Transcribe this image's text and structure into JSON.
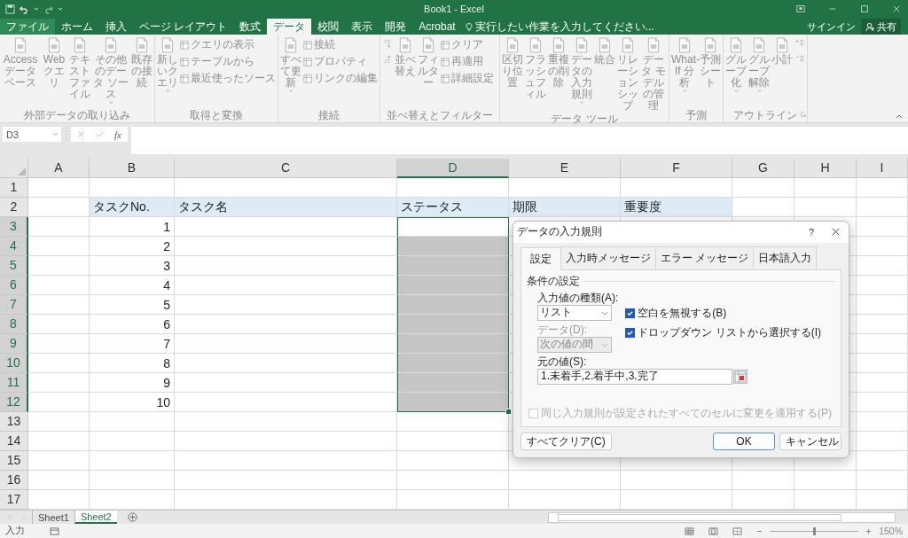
{
  "window": {
    "title": "Book1 - Excel"
  },
  "ribbon_tabs": [
    {
      "label": "ファイル",
      "selected": false,
      "kind": "file"
    },
    {
      "label": "ホーム",
      "selected": false
    },
    {
      "label": "挿入",
      "selected": false
    },
    {
      "label": "ページ レイアウト",
      "selected": false
    },
    {
      "label": "数式",
      "selected": false
    },
    {
      "label": "データ",
      "selected": true
    },
    {
      "label": "校閲",
      "selected": false
    },
    {
      "label": "表示",
      "selected": false
    },
    {
      "label": "開発",
      "selected": false
    },
    {
      "label": "Acrobat",
      "selected": false
    }
  ],
  "tell_me": {
    "placeholder": "実行したい作業を入力してください..."
  },
  "sign_in": "サインイン",
  "share": "共有",
  "ribbon": {
    "enabled": false,
    "groups": [
      {
        "label": "外部データの取り込み",
        "items": [
          {
            "kind": "large",
            "label": "Access データベース"
          },
          {
            "kind": "large",
            "label": "Web クエリ"
          },
          {
            "kind": "large",
            "label": "テキストファイル"
          },
          {
            "kind": "large",
            "label": "その他のデータ ソース",
            "dropdown": true
          },
          {
            "kind": "large",
            "label": "既存の接続"
          }
        ]
      },
      {
        "label": "取得と変換",
        "items": [
          {
            "kind": "large",
            "label": "新しいクエリ",
            "dropdown": true
          },
          {
            "kind": "small",
            "label": "クエリの表示"
          },
          {
            "kind": "small",
            "label": "テーブルから"
          },
          {
            "kind": "small",
            "label": "最近使ったソース"
          }
        ]
      },
      {
        "label": "接続",
        "items": [
          {
            "kind": "large",
            "label": "すべて更新",
            "dropdown": true
          },
          {
            "kind": "small",
            "label": "接続"
          },
          {
            "kind": "small",
            "label": "プロパティ"
          },
          {
            "kind": "small",
            "label": "リンクの編集"
          }
        ]
      },
      {
        "label": "並べ替えとフィルター",
        "items": [
          {
            "kind": "sort"
          },
          {
            "kind": "large",
            "label": "並べ替え"
          },
          {
            "kind": "large",
            "label": "フィルター"
          },
          {
            "kind": "small",
            "label": "クリア"
          },
          {
            "kind": "small",
            "label": "再適用"
          },
          {
            "kind": "small",
            "label": "詳細設定"
          }
        ]
      },
      {
        "label": "データ ツール",
        "items": [
          {
            "kind": "large",
            "label": "区切り位置"
          },
          {
            "kind": "large",
            "label": "フラッシュフィル"
          },
          {
            "kind": "large",
            "label": "重複の削除"
          },
          {
            "kind": "large",
            "label": "データの入力規則",
            "dropdown": true
          },
          {
            "kind": "large",
            "label": "統合"
          },
          {
            "kind": "large",
            "label": "リレーションシップ"
          },
          {
            "kind": "large",
            "label": "データ モデルの管理"
          }
        ]
      },
      {
        "label": "予測",
        "items": [
          {
            "kind": "large",
            "label": "What-If 分析",
            "dropdown": true
          },
          {
            "kind": "large",
            "label": "予測シート"
          }
        ]
      },
      {
        "label": "アウトライン",
        "launcher": true,
        "items": [
          {
            "kind": "large",
            "label": "グループ化",
            "dropdown": true
          },
          {
            "kind": "large",
            "label": "グループ解除",
            "dropdown": true
          },
          {
            "kind": "large",
            "label": "小計"
          },
          {
            "kind": "outline"
          }
        ]
      }
    ]
  },
  "formula_bar": {
    "name_box": "D3",
    "function_label": "fx"
  },
  "sheet": {
    "columns": [
      {
        "label": "A",
        "selected": false
      },
      {
        "label": "B",
        "selected": false
      },
      {
        "label": "C",
        "selected": false
      },
      {
        "label": "D",
        "selected": true
      },
      {
        "label": "E",
        "selected": false
      },
      {
        "label": "F",
        "selected": false
      },
      {
        "label": "G",
        "selected": false
      },
      {
        "label": "H",
        "selected": false
      },
      {
        "label": "I",
        "selected": false
      }
    ],
    "rows": [
      {
        "label": "1",
        "selected": false,
        "cells": []
      },
      {
        "label": "2",
        "selected": false,
        "kind": "header",
        "cells": [
          {
            "text": "",
            "kind": "text"
          },
          {
            "text": "タスクNo.",
            "kind": "text"
          },
          {
            "text": "タスク名",
            "kind": "text"
          },
          {
            "text": "ステータス",
            "kind": "text"
          },
          {
            "text": "期限",
            "kind": "text"
          },
          {
            "text": "重要度",
            "kind": "text"
          }
        ]
      },
      {
        "label": "3",
        "selected": true,
        "cells": [
          {
            "text": "",
            "kind": "text"
          },
          {
            "text": "1",
            "kind": "number"
          }
        ]
      },
      {
        "label": "4",
        "selected": true,
        "cells": [
          {
            "text": "",
            "kind": "text"
          },
          {
            "text": "2",
            "kind": "number"
          }
        ]
      },
      {
        "label": "5",
        "selected": true,
        "cells": [
          {
            "text": "",
            "kind": "text"
          },
          {
            "text": "3",
            "kind": "number"
          }
        ]
      },
      {
        "label": "6",
        "selected": true,
        "cells": [
          {
            "text": "",
            "kind": "text"
          },
          {
            "text": "4",
            "kind": "number"
          }
        ]
      },
      {
        "label": "7",
        "selected": true,
        "cells": [
          {
            "text": "",
            "kind": "text"
          },
          {
            "text": "5",
            "kind": "number"
          }
        ]
      },
      {
        "label": "8",
        "selected": true,
        "cells": [
          {
            "text": "",
            "kind": "text"
          },
          {
            "text": "6",
            "kind": "number"
          }
        ]
      },
      {
        "label": "9",
        "selected": true,
        "cells": [
          {
            "text": "",
            "kind": "text"
          },
          {
            "text": "7",
            "kind": "number"
          }
        ]
      },
      {
        "label": "10",
        "selected": true,
        "cells": [
          {
            "text": "",
            "kind": "text"
          },
          {
            "text": "8",
            "kind": "number"
          }
        ]
      },
      {
        "label": "11",
        "selected": true,
        "cells": [
          {
            "text": "",
            "kind": "text"
          },
          {
            "text": "9",
            "kind": "number"
          }
        ]
      },
      {
        "label": "12",
        "selected": true,
        "cells": [
          {
            "text": "",
            "kind": "text"
          },
          {
            "text": "10",
            "kind": "number"
          }
        ]
      },
      {
        "label": "13",
        "selected": false,
        "cells": []
      },
      {
        "label": "14",
        "selected": false,
        "cells": []
      },
      {
        "label": "15",
        "selected": false,
        "cells": []
      },
      {
        "label": "16",
        "selected": false,
        "cells": []
      },
      {
        "label": "17",
        "selected": false,
        "cells": []
      }
    ]
  },
  "sheet_tabs": [
    {
      "label": "Sheet1",
      "selected": false
    },
    {
      "label": "Sheet2",
      "selected": true
    }
  ],
  "status_bar": {
    "mode": "入力",
    "zoom": "150%",
    "zoom_slider": {
      "level": 0.5
    }
  },
  "dialog": {
    "title": "データの入力規則",
    "help": "?",
    "tabs": [
      {
        "label": "設定",
        "selected": true
      },
      {
        "label": "入力時メッセージ",
        "selected": false
      },
      {
        "label": "エラー メッセージ",
        "selected": false
      },
      {
        "label": "日本語入力",
        "selected": false
      }
    ],
    "section": "条件の設定",
    "allow": {
      "label": "入力値の種類(A):",
      "value": "リスト"
    },
    "ignore_blank": {
      "label": "空白を無視する(B)",
      "checked": true
    },
    "in_cell_dropdown": {
      "label": "ドロップダウン リストから選択する(I)",
      "checked": true
    },
    "data": {
      "label": "データ(D):",
      "value": "次の値の間",
      "disabled": true
    },
    "source": {
      "label": "元の値(S):",
      "value": "1.未着手,2.着手中,3.完了"
    },
    "apply_all": {
      "label": "同じ入力規則が設定されたすべてのセルに変更を適用する(P)",
      "checked": false,
      "disabled": true
    },
    "buttons": [
      {
        "label": "すべてクリア(C)",
        "kind": "left"
      },
      {
        "label": "OK",
        "kind": "default"
      },
      {
        "label": "キャンセル",
        "kind": "normal"
      }
    ]
  }
}
